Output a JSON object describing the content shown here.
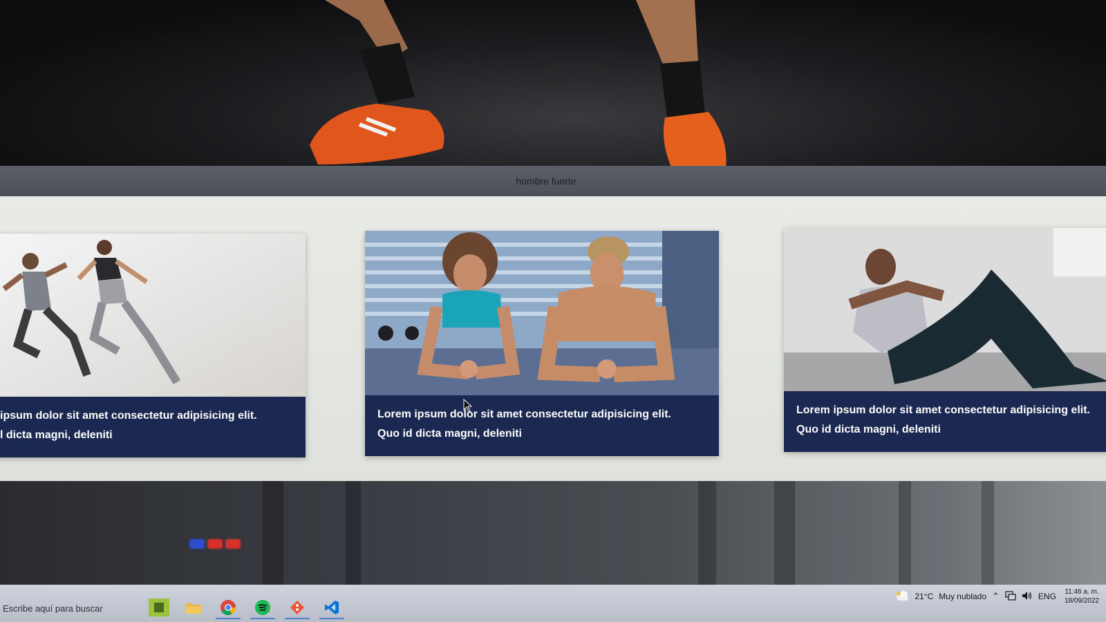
{
  "hero": {
    "caption": "hombre fuerte"
  },
  "cards": [
    {
      "line1": "ipsum dolor sit amet consectetur adipisicing elit.",
      "line2": "l dicta magni, deleniti"
    },
    {
      "line1": "Lorem ipsum dolor sit amet consectetur adipisicing elit.",
      "line2": "Quo id dicta magni, deleniti"
    },
    {
      "line1": "Lorem ipsum dolor sit amet consectetur adipisicing elit.",
      "line2": "Quo id dicta magni, deleniti"
    }
  ],
  "taskbar": {
    "search_placeholder": "Escribe aquí para buscar",
    "apps": [
      "file-explorer-icon",
      "chrome-icon",
      "spotify-icon",
      "git-icon",
      "vscode-icon"
    ],
    "weather_temp": "21°C",
    "weather_text": "Muy nublado",
    "language": "ENG",
    "time": "11:46 a. m.",
    "date": "18/09/2022"
  },
  "colors": {
    "card_text_bg": "#1b2852",
    "band_bg": "#e9ebe6",
    "caption_bar": "#555a62"
  }
}
